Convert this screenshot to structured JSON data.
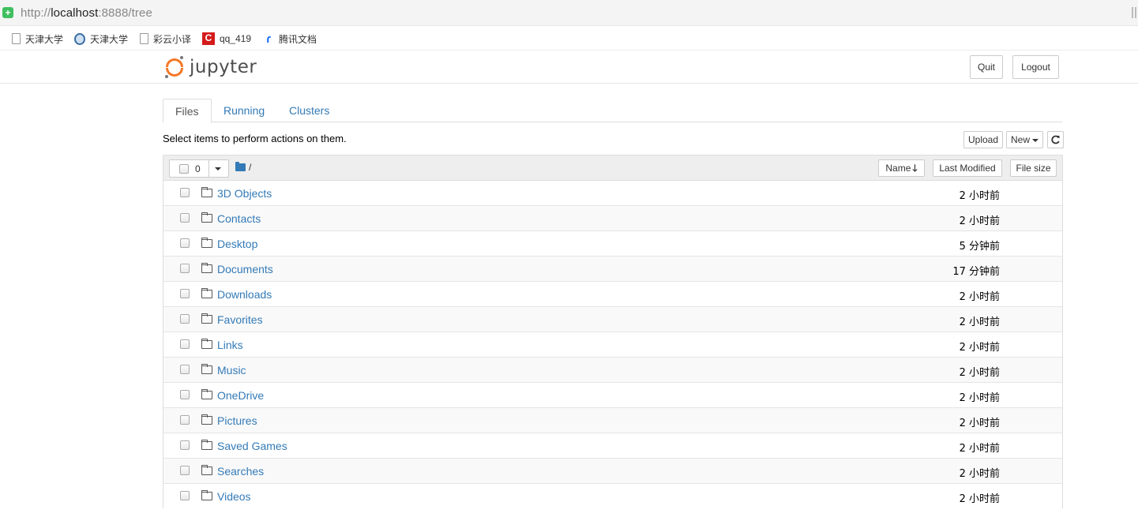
{
  "browser": {
    "url_prefix": "http://",
    "url_host": "localhost",
    "url_rest": ":8888/tree",
    "bookmarks": [
      {
        "icon": "page-icon",
        "label": "天津大学"
      },
      {
        "icon": "globe-icon",
        "label": "天津大学"
      },
      {
        "icon": "page-icon",
        "label": "彩云小译"
      },
      {
        "icon": "c-logo-icon",
        "label": "qq_419"
      },
      {
        "icon": "tencent-docs-icon",
        "label": "腾讯文档"
      }
    ]
  },
  "header": {
    "logo_text": "jupyter",
    "quit_label": "Quit",
    "logout_label": "Logout"
  },
  "tabs": [
    {
      "label": "Files",
      "active": true
    },
    {
      "label": "Running",
      "active": false
    },
    {
      "label": "Clusters",
      "active": false
    }
  ],
  "toolbar": {
    "hint": "Select items to perform actions on them.",
    "upload_label": "Upload",
    "new_label": "New",
    "refresh_icon": "refresh-icon"
  },
  "list_header": {
    "selected_count": "0",
    "breadcrumb": "/",
    "sort_name_label": "Name",
    "sort_name_arrow": "🡓",
    "last_modified_label": "Last Modified",
    "file_size_label": "File size"
  },
  "items": [
    {
      "name": "3D Objects",
      "modified": "2 小时前"
    },
    {
      "name": "Contacts",
      "modified": "2 小时前"
    },
    {
      "name": "Desktop",
      "modified": "5 分钟前"
    },
    {
      "name": "Documents",
      "modified": "17 分钟前"
    },
    {
      "name": "Downloads",
      "modified": "2 小时前"
    },
    {
      "name": "Favorites",
      "modified": "2 小时前"
    },
    {
      "name": "Links",
      "modified": "2 小时前"
    },
    {
      "name": "Music",
      "modified": "2 小时前"
    },
    {
      "name": "OneDrive",
      "modified": "2 小时前"
    },
    {
      "name": "Pictures",
      "modified": "2 小时前"
    },
    {
      "name": "Saved Games",
      "modified": "2 小时前"
    },
    {
      "name": "Searches",
      "modified": "2 小时前"
    },
    {
      "name": "Videos",
      "modified": "2 小时前"
    }
  ],
  "colors": {
    "link": "#337ab7",
    "jupyter_orange": "#f37726"
  }
}
